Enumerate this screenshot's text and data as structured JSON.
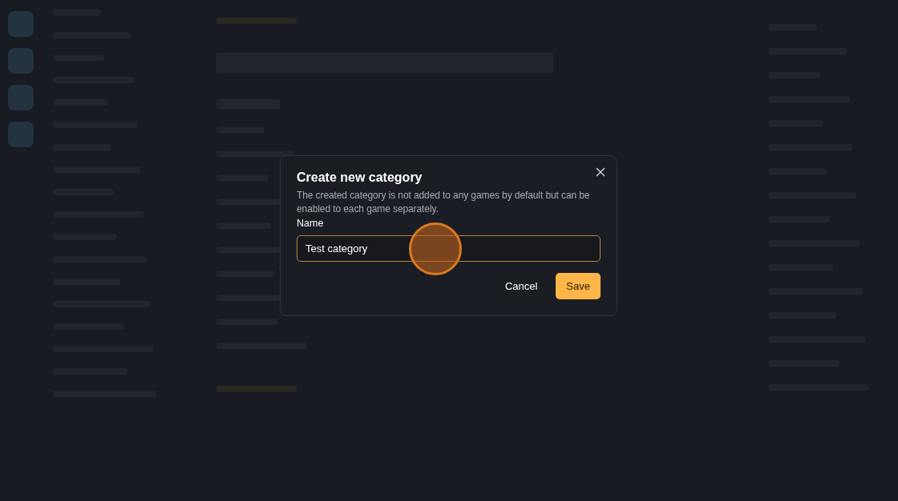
{
  "dialog": {
    "title": "Create new category",
    "description": "The created category is not added to any games by default but can be enabled to each game separately.",
    "field_label": "Name",
    "field": {
      "value": "Test category",
      "focused": true
    },
    "buttons": [
      {
        "label": "Cancel",
        "kind": "secondary"
      },
      {
        "label": "Save",
        "kind": "primary"
      }
    ]
  }
}
